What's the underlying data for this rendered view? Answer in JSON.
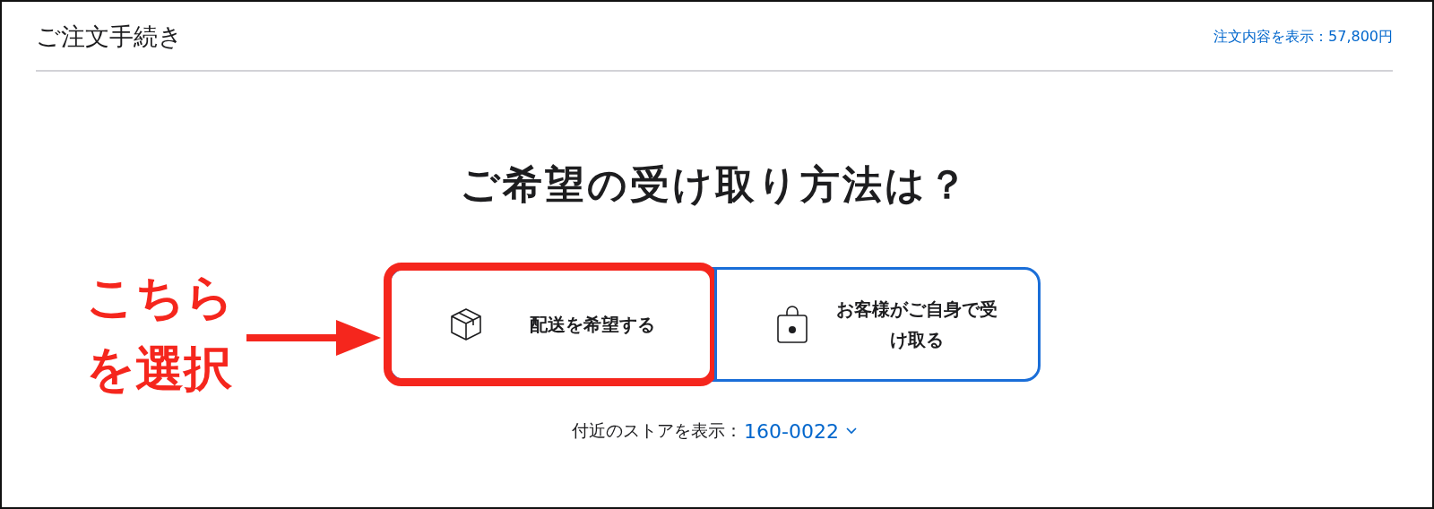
{
  "header": {
    "title": "ご注文手続き",
    "summary_link": "注文内容を表示：57,800円"
  },
  "question": "ご希望の受け取り方法は？",
  "options": [
    {
      "kind": "delivery",
      "label": "配送を希望する",
      "selected": false,
      "highlighted": true
    },
    {
      "kind": "pickup",
      "label": "お客様がご自身で受け取る",
      "selected": false,
      "highlighted": false
    }
  ],
  "annotation": {
    "lines": [
      "こちら",
      "を選択"
    ]
  },
  "store_lookup": {
    "label": "付近のストアを表示：",
    "postal_code": "160-0022"
  }
}
